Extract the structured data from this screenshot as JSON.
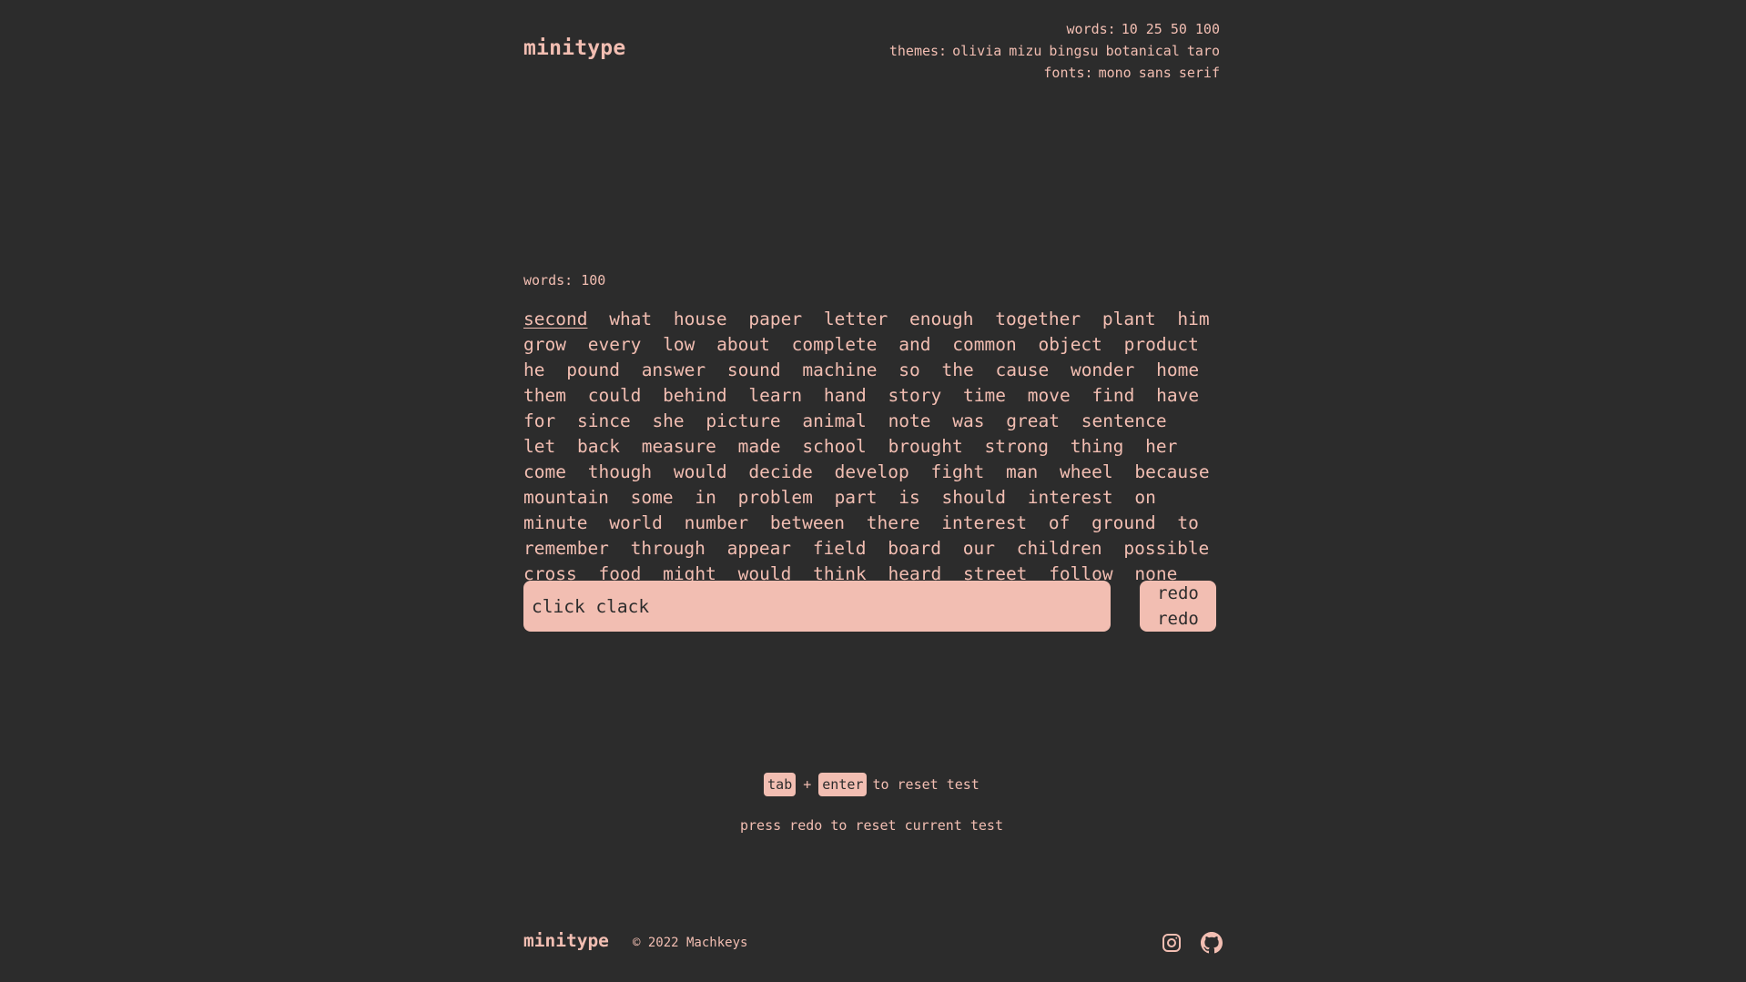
{
  "header": {
    "logo": "minitype",
    "words_label": "words:",
    "word_options": [
      "10",
      "25",
      "50",
      "100"
    ],
    "themes_label": "themes:",
    "theme_options": [
      "olivia",
      "mizu",
      "bingsu",
      "botanical",
      "taro"
    ],
    "fonts_label": "fonts:",
    "font_options": [
      "mono",
      "sans",
      "serif"
    ]
  },
  "test": {
    "word_count_label": "words: 100",
    "current_word": "second",
    "words": [
      "what",
      "house",
      "paper",
      "letter",
      "enough",
      "together",
      "plant",
      "him",
      "grow",
      "every",
      "low",
      "about",
      "complete",
      "and",
      "common",
      "object",
      "product",
      "he",
      "pound",
      "answer",
      "sound",
      "machine",
      "so",
      "the",
      "cause",
      "wonder",
      "home",
      "them",
      "could",
      "behind",
      "learn",
      "hand",
      "story",
      "time",
      "move",
      "find",
      "have",
      "for",
      "since",
      "she",
      "picture",
      "animal",
      "note",
      "was",
      "great",
      "sentence",
      "let",
      "back",
      "measure",
      "made",
      "school",
      "brought",
      "strong",
      "thing",
      "her",
      "come",
      "though",
      "would",
      "decide",
      "develop",
      "fight",
      "man",
      "wheel",
      "because",
      "mountain",
      "some",
      "in",
      "problem",
      "part",
      "is",
      "should",
      "interest",
      "on",
      "minute",
      "world",
      "number",
      "between",
      "there",
      "interest",
      "of",
      "ground",
      "to",
      "remember",
      "through",
      "appear",
      "field",
      "board",
      "our",
      "children",
      "possible",
      "cross",
      "food",
      "might",
      "would",
      "think",
      "heard",
      "street",
      "follow",
      "none"
    ],
    "input_placeholder": "click clack",
    "redo_label": "redo",
    "redo_label_2": "redo"
  },
  "hints": {
    "key_tab": "tab",
    "plus": "+",
    "key_enter": "enter",
    "reset_text": "to reset test",
    "redo_text": "press redo to reset current test"
  },
  "footer": {
    "logo": "minitype",
    "copyright": "© 2022 Machkeys",
    "icons": [
      "instagram-icon",
      "github-icon"
    ]
  },
  "colors": {
    "background": "#2c2c2c",
    "accent": "#f2beb2"
  }
}
